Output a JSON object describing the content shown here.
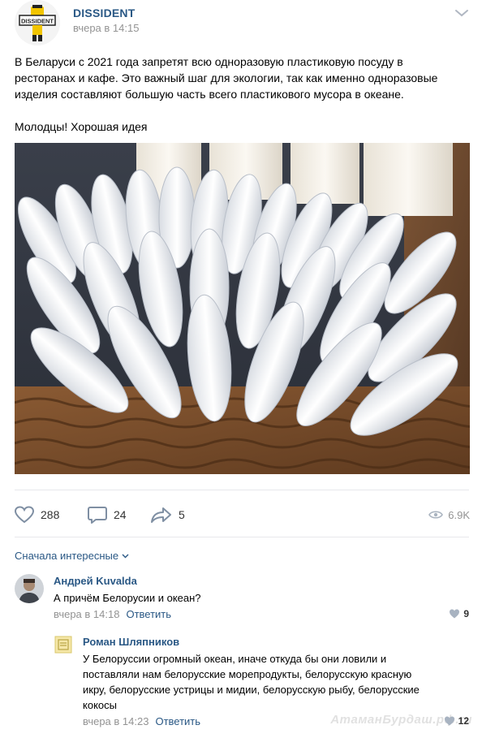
{
  "post": {
    "author": "DISSIDENT",
    "time": "вчера в 14:15",
    "logo_text": "DISSIDENT",
    "text_line1": "В Беларуси с 2021 года запретят всю одноразовую пластиковую посуду в",
    "text_line2": "ресторанах и кафе. Это важный шаг для экологии, так как именно одноразовые",
    "text_line3": "изделия составляют большую часть всего пластикового мусора в океане.",
    "text_line4": "Молодцы! Хорошая идея",
    "image_icon": "photo-plastic-cutlery"
  },
  "actions": {
    "likes": "288",
    "comments": "24",
    "shares": "5",
    "views": "6.9K"
  },
  "comments_section": {
    "sort_label": "Сначала интересные"
  },
  "comment": {
    "author": "Андрей Kuvalda",
    "text": "А причём Белорусии и океан?",
    "time": "вчера в 14:18",
    "reply_label": "Ответить",
    "likes": "9"
  },
  "reply": {
    "author": "Роман Шляпников",
    "line1": "У Белоруссии огромный океан, иначе откуда бы они ловили и",
    "line2": "поставляли нам белорусские морепродукты, белорусскую красную",
    "line3": "икру, белорусские устрицы и мидии, белорусскую рыбу, белорусские",
    "line4": "кокосы",
    "time": "вчера в 14:23",
    "reply_label": "Ответить",
    "likes": "12"
  },
  "watermark": "АтаманБурдаш.рф.ru",
  "colors": {
    "link": "#2a5885",
    "muted": "#939393",
    "divider": "#e7e8ec",
    "icon": "#7f8fa3"
  }
}
